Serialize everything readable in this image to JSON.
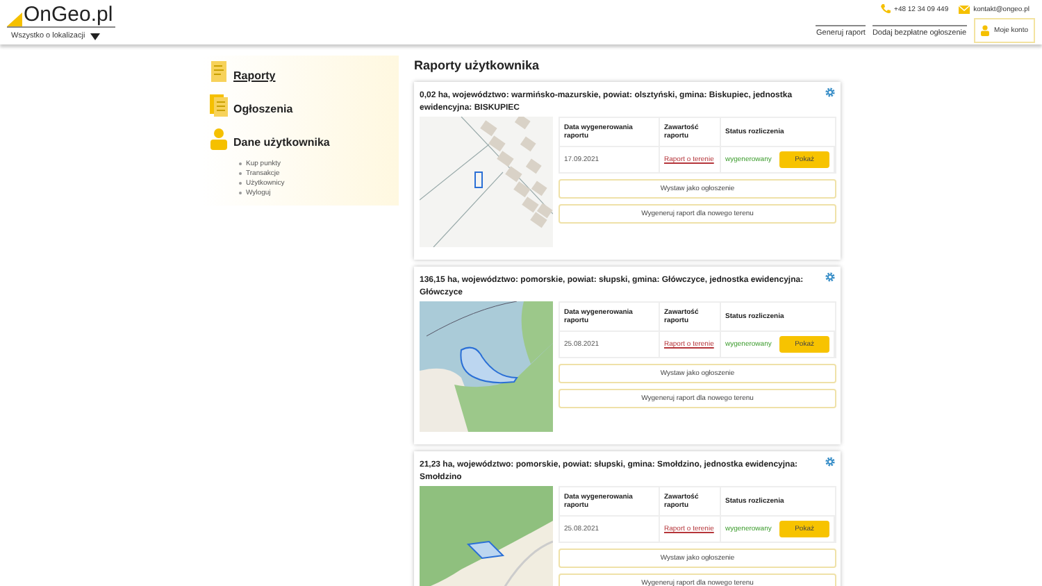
{
  "header": {
    "logo": "OnGeo.pl",
    "location_dropdown": "Wszystko o lokalizacji",
    "phone": "+48 12 34 09 449",
    "email": "kontakt@ongeo.pl",
    "nav": [
      "Generuj raport",
      "Dodaj bezpłatne ogłoszenie"
    ],
    "account_button": "Moje konto"
  },
  "sidebar": {
    "items": [
      {
        "label": "Raporty",
        "kind": "reports",
        "selected": true
      },
      {
        "label": "Ogłoszenia",
        "kind": "ads",
        "selected": false
      },
      {
        "label": "Dane użytkownika",
        "kind": "user",
        "selected": false,
        "children": [
          "Kup punkty",
          "Transakcje",
          "Użytkownicy",
          "Wyloguj"
        ]
      }
    ]
  },
  "main": {
    "title": "Raporty użytkownika",
    "reports": [
      {
        "title": "0,02 ha, województwo: warmińsko-mazurskie, powiat: olsztyński, gmina: Biskupiec, jednostka ewidencyjna: BISKUPIEC",
        "map": {
          "kind": "cadastral"
        },
        "table_headers": [
          "Data wygenerowania raportu",
          "Zawartość raportu",
          "Status rozliczenia"
        ],
        "date": "17.09.2021",
        "content_link": "Raport o terenie",
        "status": "wygenerowany",
        "show_button": "Pokaż",
        "actions": [
          "Wystaw jako ogłoszenie",
          "Wygeneruj raport dla nowego terenu"
        ]
      },
      {
        "title": "136,15 ha, województwo: pomorskie, powiat: słupski, gmina: Główczyce, jednostka ewidencyjna: Główczyce",
        "map": {
          "kind": "coastal"
        },
        "table_headers": [
          "Data wygenerowania raportu",
          "Zawartość raportu",
          "Status rozliczenia"
        ],
        "date": "25.08.2021",
        "content_link": "Raport o terenie",
        "status": "wygenerowany",
        "show_button": "Pokaż",
        "actions": [
          "Wystaw jako ogłoszenie",
          "Wygeneruj raport dla nowego terenu"
        ]
      },
      {
        "title": "21,23 ha, województwo: pomorskie, powiat: słupski, gmina: Smołdzino, jednostka ewidencyjna: Smołdzino",
        "map": {
          "kind": "forest"
        },
        "table_headers": [
          "Data wygenerowania raportu",
          "Zawartość raportu",
          "Status rozliczenia"
        ],
        "date": "25.08.2021",
        "content_link": "Raport o terenie",
        "status": "wygenerowany",
        "show_button": "Pokaż",
        "actions": [
          "Wystaw jako ogłoszenie",
          "Wygeneruj raport dla nowego terenu"
        ]
      }
    ]
  }
}
